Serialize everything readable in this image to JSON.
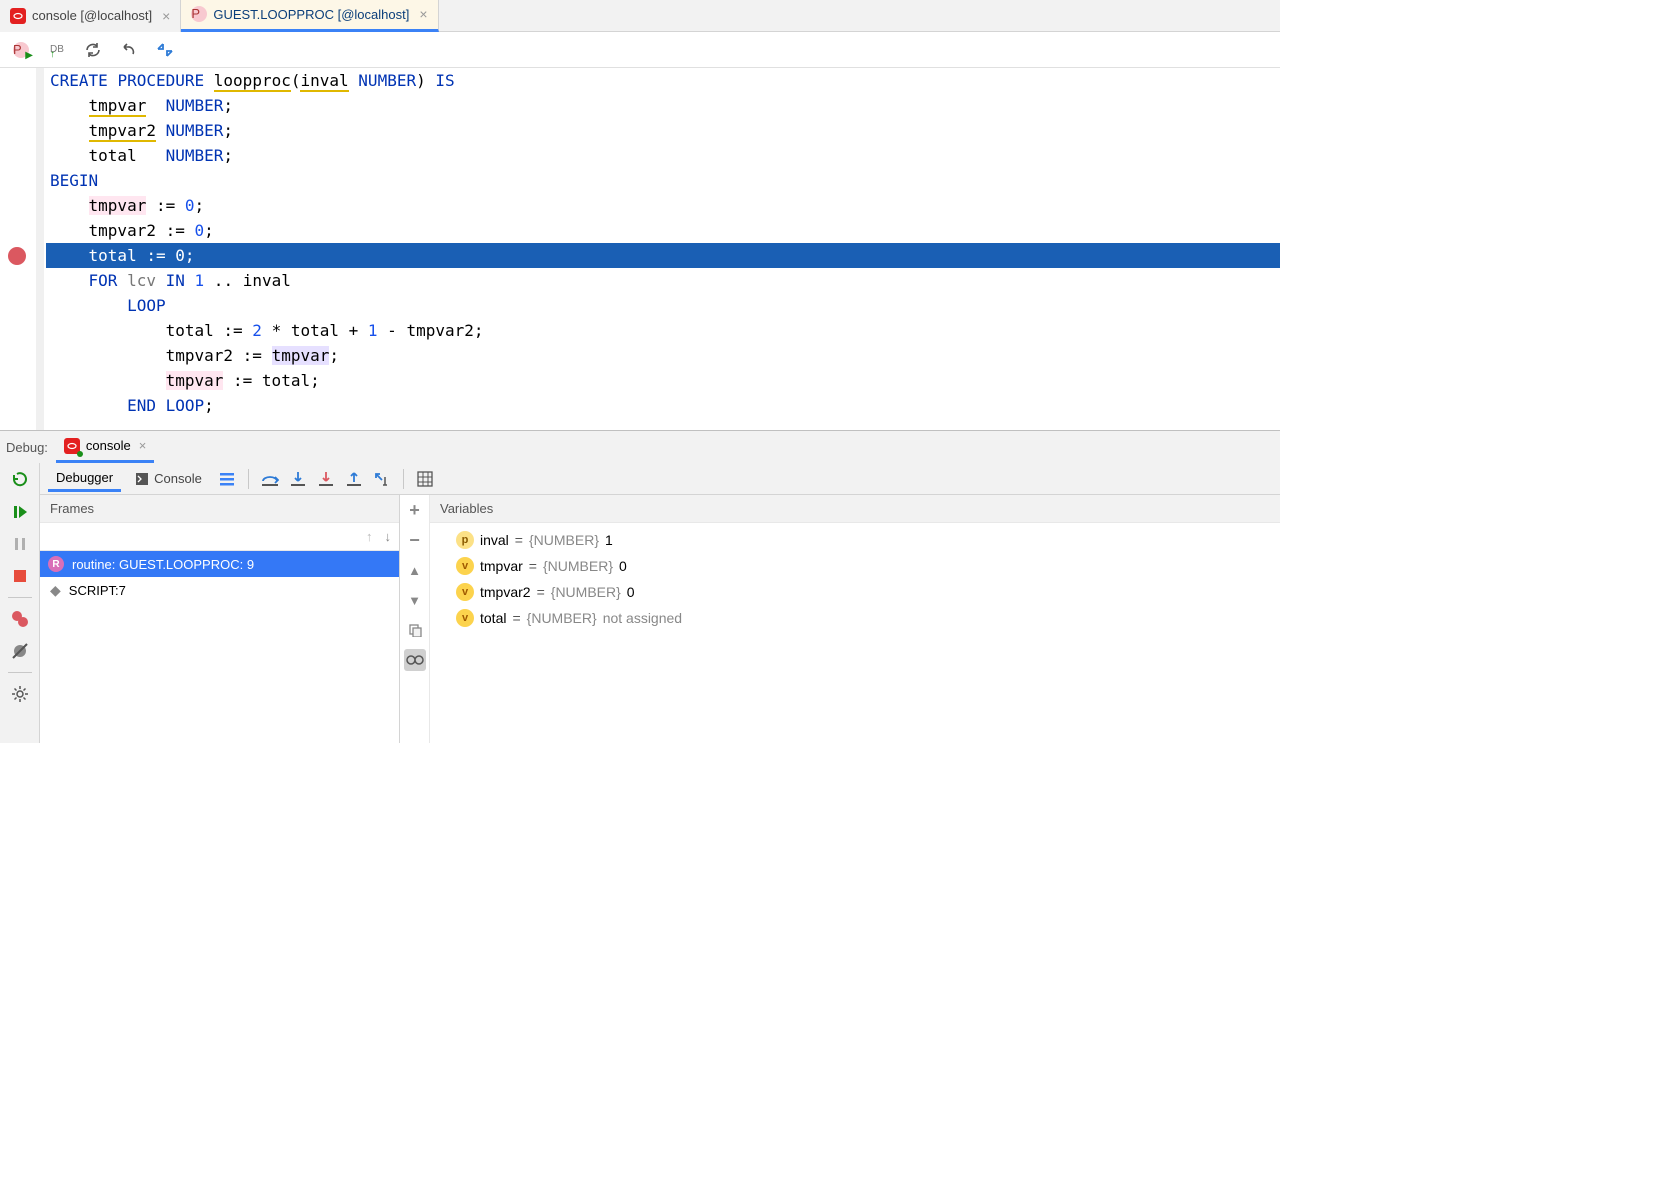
{
  "tabs": [
    {
      "label": "console [@localhost]",
      "icon": "oracle"
    },
    {
      "label": "GUEST.LOOPPROC [@localhost]",
      "icon": "p",
      "active": true
    }
  ],
  "code": {
    "lines": [
      {
        "t": "CREATE PROCEDURE loopproc(inval NUMBER) IS",
        "cls": ""
      },
      {
        "t": "    tmpvar  NUMBER;",
        "cls": ""
      },
      {
        "t": "    tmpvar2 NUMBER;",
        "cls": ""
      },
      {
        "t": "    total   NUMBER;",
        "cls": ""
      },
      {
        "t": "BEGIN",
        "cls": ""
      },
      {
        "t": "    tmpvar := 0;",
        "cls": ""
      },
      {
        "t": "    tmpvar2 := 0;",
        "cls": ""
      },
      {
        "t": "    total := 0;",
        "cls": "current"
      },
      {
        "t": "    FOR lcv IN 1 .. inval",
        "cls": ""
      },
      {
        "t": "        LOOP",
        "cls": ""
      },
      {
        "t": "            total := 2 * total + 1 - tmpvar2;",
        "cls": ""
      },
      {
        "t": "            tmpvar2 := tmpvar;",
        "cls": ""
      },
      {
        "t": "            tmpvar := total;",
        "cls": ""
      },
      {
        "t": "        END LOOP;",
        "cls": ""
      }
    ]
  },
  "debug": {
    "title": "Debug:",
    "tab_label": "console",
    "tabs": {
      "debugger": "Debugger",
      "console": "Console"
    },
    "frames_header": "Frames",
    "variables_header": "Variables",
    "frames": [
      {
        "label": "routine: GUEST.LOOPPROC: 9",
        "selected": true,
        "icon": "R"
      },
      {
        "label": "SCRIPT:7",
        "selected": false,
        "icon": "diamond"
      }
    ],
    "variables": [
      {
        "badge": "p",
        "name": "inval",
        "type": "{NUMBER}",
        "value": "1"
      },
      {
        "badge": "v",
        "name": "tmpvar",
        "type": "{NUMBER}",
        "value": "0"
      },
      {
        "badge": "v",
        "name": "tmpvar2",
        "type": "{NUMBER}",
        "value": "0"
      },
      {
        "badge": "v",
        "name": "total",
        "type": "{NUMBER}",
        "value": "not assigned",
        "na": true
      }
    ]
  }
}
